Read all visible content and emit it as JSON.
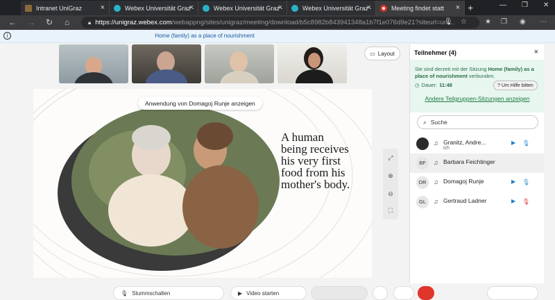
{
  "tabs": [
    {
      "label": "Intranet UniGraz",
      "close": "×",
      "active": false,
      "favicon": "unigraz-favicon"
    },
    {
      "label": "Webex Universität Graz - ",
      "close": "×",
      "active": false,
      "favicon": "webex-favicon"
    },
    {
      "label": "Webex Universität Graz - ",
      "close": "×",
      "active": false,
      "favicon": "webex-favicon"
    },
    {
      "label": "Webex Universität Graz - ",
      "close": "×",
      "active": false,
      "favicon": "webex-favicon"
    },
    {
      "label": "Meeting findet statt",
      "close": "×",
      "active": true,
      "favicon": "meeting-favicon"
    }
  ],
  "newtab_label": "+",
  "window_controls": {
    "minimize": "—",
    "maximize": "❐",
    "close": "✕"
  },
  "address": {
    "host": "https://unigraz.webex.com",
    "path": "/webappng/sites/unigraz/meeting/download/b5c8982b843941348a1b7f1e076d9e21?siteurl=uni..."
  },
  "meeting_title": "Home (family) as a place of nourishment",
  "layout_button": "Layout",
  "share_label": "Anwendung von Domagoj Runje anzeigen",
  "slide_text": [
    "A human",
    "being receives",
    "his very first",
    "food from his",
    "mother's body."
  ],
  "panel": {
    "title": "Teilnehmer (4)",
    "close": "×",
    "session_msg_prefix": "Sie sind derzeit mit der Sitzung ",
    "session_name": "Home (family) as a place of nourishment",
    "session_msg_suffix": " verbunden.",
    "duration_label": "Dauer:",
    "duration_value": "11:48",
    "help_button": "Um Hilfe bitten",
    "other_sessions_link": "Andere Teilgruppen-Sitzungen anzeigen",
    "search_placeholder": "Suche",
    "participants": [
      {
        "initials": "",
        "name": "Granitz, Andre...",
        "sub": "ich",
        "video": true,
        "mic": "on"
      },
      {
        "initials": "BF",
        "name": "Barbara Feichtinger",
        "sub": "",
        "video": false,
        "mic": "none"
      },
      {
        "initials": "DR",
        "name": "Domagoj Runje",
        "sub": "",
        "video": true,
        "mic": "on"
      },
      {
        "initials": "GL",
        "name": "Gertraud Ladner",
        "sub": "",
        "video": true,
        "mic": "muted"
      }
    ]
  },
  "controls": {
    "mute": "Stummschalten",
    "video": "Video starten"
  },
  "colors": {
    "webex_blue": "#1f7fc6",
    "session_green": "#1c7a47",
    "muted_red": "#d9302c",
    "leave_red": "#e0352b"
  }
}
